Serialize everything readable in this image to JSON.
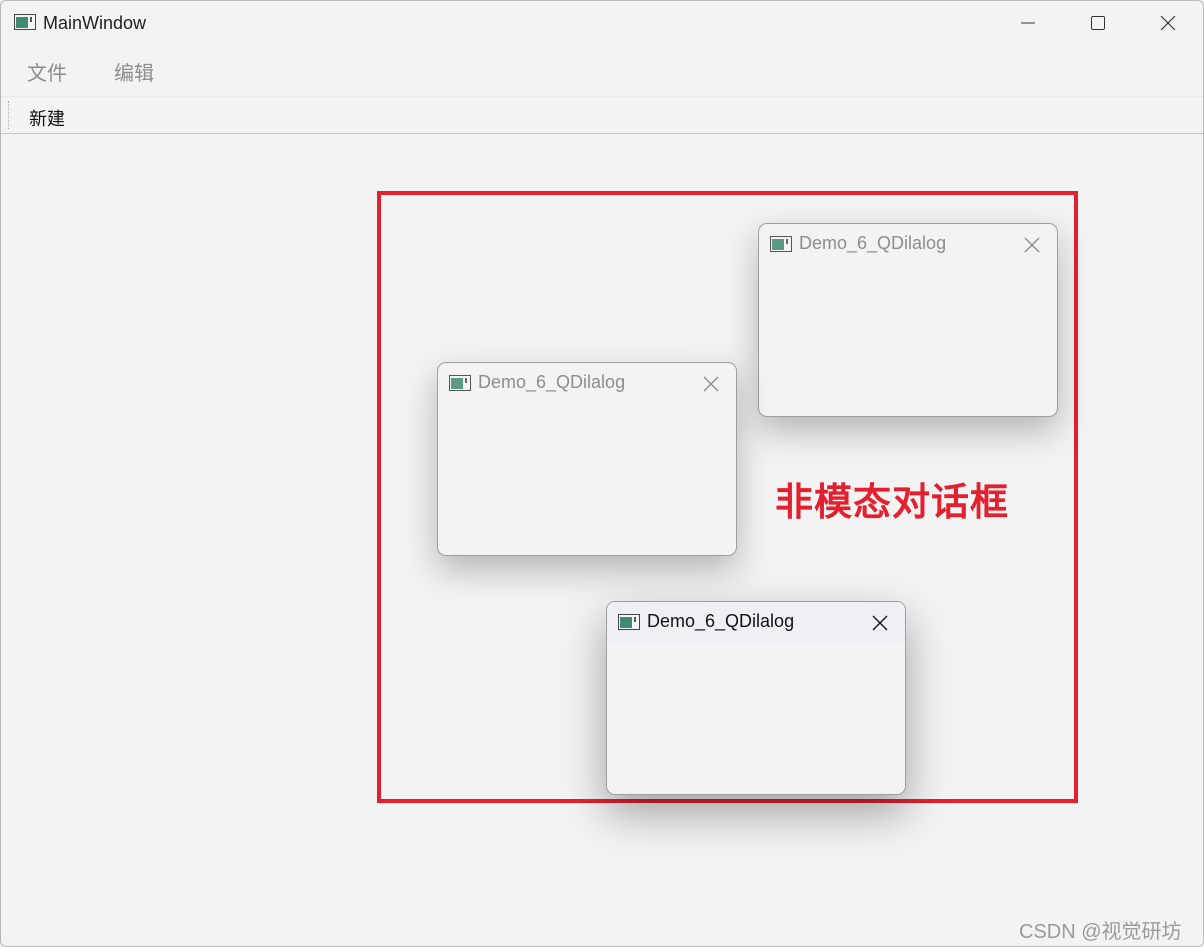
{
  "window": {
    "title": "MainWindow",
    "icon": "qt-window-icon"
  },
  "window_controls": {
    "minimize": "minimize-icon",
    "maximize": "maximize-icon",
    "close": "close-icon"
  },
  "menubar": {
    "items": [
      {
        "label": "文件"
      },
      {
        "label": "编辑"
      }
    ]
  },
  "toolbar": {
    "actions": [
      {
        "label": "新建"
      }
    ]
  },
  "annotation": {
    "label": "非模态对话框",
    "color": "#e5202e"
  },
  "dialogs": [
    {
      "title": "Demo_6_QDilalog",
      "active": false
    },
    {
      "title": "Demo_6_QDilalog",
      "active": false
    },
    {
      "title": "Demo_6_QDilalog",
      "active": true
    }
  ],
  "watermark": "CSDN @视觉研坊"
}
